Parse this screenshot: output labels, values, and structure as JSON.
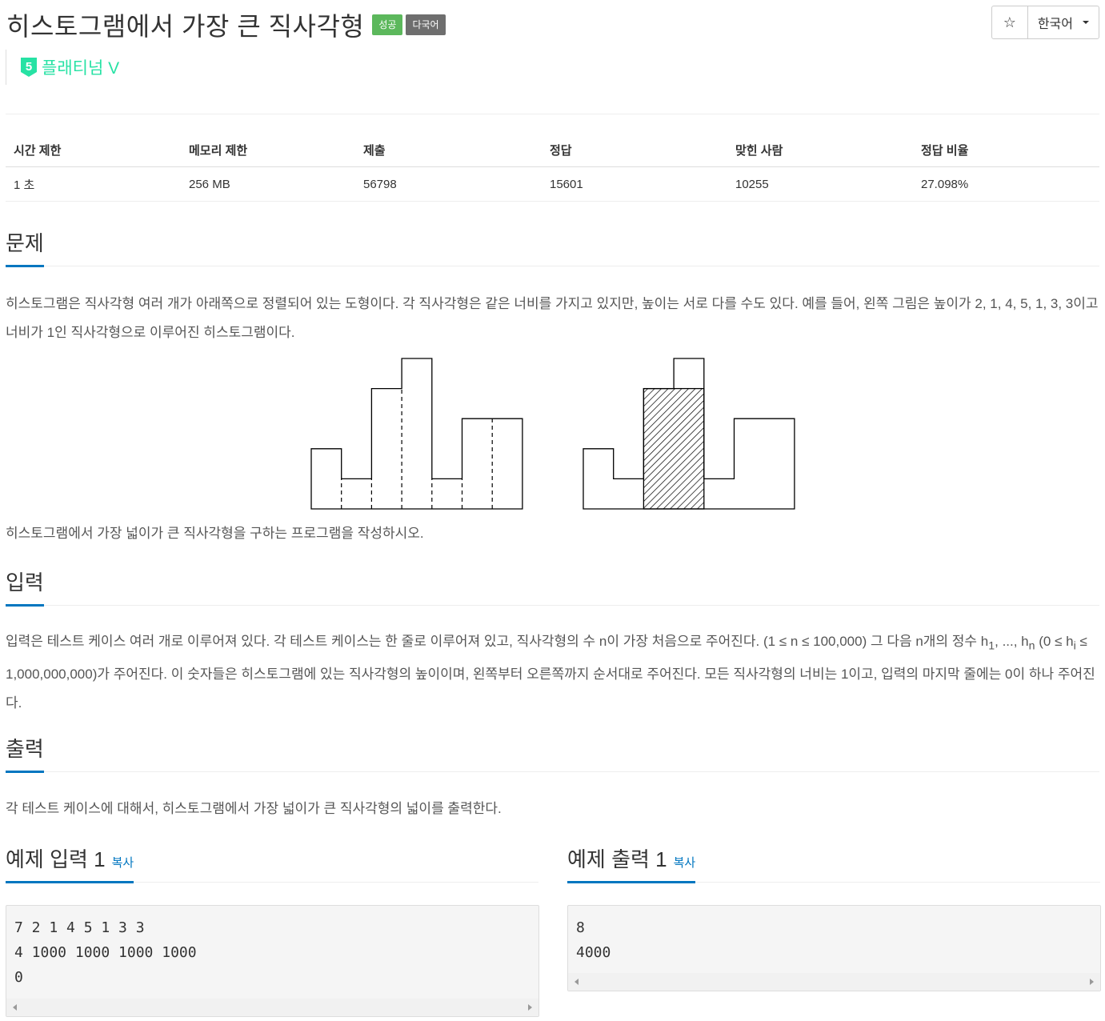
{
  "header": {
    "title": "히스토그램에서 가장 큰 직사각형",
    "badges": [
      "성공",
      "다국어"
    ],
    "star_icon": "star-icon",
    "language": "한국어"
  },
  "tier": {
    "number": "5",
    "name": "플래티넘 V",
    "color": "#27e2a4"
  },
  "stats": {
    "headers": [
      "시간 제한",
      "메모리 제한",
      "제출",
      "정답",
      "맞힌 사람",
      "정답 비율"
    ],
    "values": [
      "1 초",
      "256 MB",
      "56798",
      "15601",
      "10255",
      "27.098%"
    ]
  },
  "problem": {
    "heading": "문제",
    "text1": "히스토그램은 직사각형 여러 개가 아래쪽으로 정렬되어 있는 도형이다. 각 직사각형은 같은 너비를 가지고 있지만, 높이는 서로 다를 수도 있다. 예를 들어, 왼쪽 그림은 높이가 2, 1, 4, 5, 1, 3, 3이고 너비가 1인 직사각형으로 이루어진 히스토그램이다.",
    "text2": "히스토그램에서 가장 넓이가 큰 직사각형을 구하는 프로그램을 작성하시오.",
    "figure_heights": [
      2,
      1,
      4,
      5,
      1,
      3,
      3
    ],
    "figure_highlight": [
      2,
      3
    ]
  },
  "input": {
    "heading": "입력",
    "text_a": "입력은 테스트 케이스 여러 개로 이루어져 있다. 각 테스트 케이스는 한 줄로 이루어져 있고, 직사각형의 수 n이 가장 처음으로 주어진다. (1 ≤ n ≤ 100,000) 그 다음 n개의 정수 h",
    "sub1": "1",
    "text_b": ", ..., h",
    "subn": "n",
    "text_c": " (0 ≤ h",
    "subi": "i",
    "text_d": " ≤ 1,000,000,000)가 주어진다. 이 숫자들은 히스토그램에 있는 직사각형의 높이이며, 왼쪽부터 오른쪽까지 순서대로 주어진다. 모든 직사각형의 너비는 1이고, 입력의 마지막 줄에는 0이 하나 주어진다."
  },
  "output": {
    "heading": "출력",
    "text": "각 테스트 케이스에 대해서, 히스토그램에서 가장 넓이가 큰 직사각형의 넓이를 출력한다."
  },
  "samples": {
    "input_title": "예제 입력 1",
    "output_title": "예제 출력 1",
    "copy_label": "복사",
    "input_text": "7 2 1 4 5 1 3 3\n4 1000 1000 1000 1000\n0",
    "output_text": "8\n4000"
  }
}
